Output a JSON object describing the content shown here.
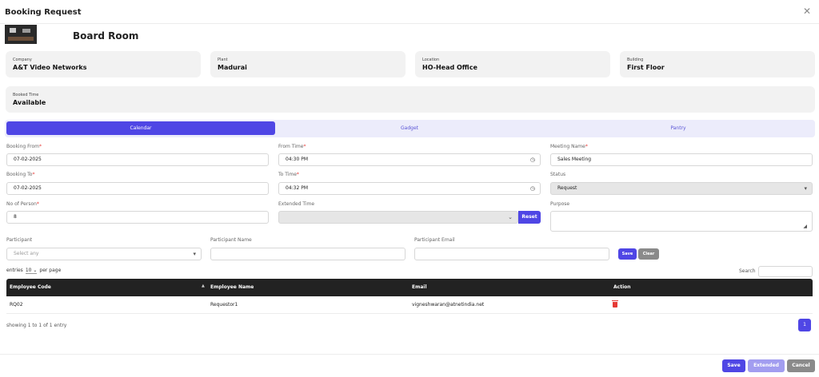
{
  "dialog": {
    "title": "Booking Request"
  },
  "room": {
    "name": "Board Room"
  },
  "info_cards": [
    {
      "label": "Company",
      "value": "A&T Video Networks"
    },
    {
      "label": "Plant",
      "value": "Madurai"
    },
    {
      "label": "Location",
      "value": "HO-Head Office"
    },
    {
      "label": "Building",
      "value": "First Floor"
    },
    {
      "label": "Booked Time",
      "value": "Available"
    }
  ],
  "tabs": [
    {
      "label": "Calendar",
      "active": true
    },
    {
      "label": "Gadget",
      "active": false
    },
    {
      "label": "Pantry",
      "active": false
    }
  ],
  "form": {
    "booking_from": {
      "label": "Booking From",
      "value": "07-02-2025"
    },
    "from_time": {
      "label": "From Time",
      "value": "04:30 PM"
    },
    "meeting_name": {
      "label": "Meeting Name",
      "value": "Sales Meeting"
    },
    "booking_to": {
      "label": "Booking To",
      "value": "07-02-2025"
    },
    "to_time": {
      "label": "To Time",
      "value": "04:32 PM"
    },
    "status": {
      "label": "Status",
      "value": "Request"
    },
    "no_of_person": {
      "label": "No of Person",
      "value": "8"
    },
    "extended_time": {
      "label": "Extended Time",
      "value": ""
    },
    "reset_label": "Reset",
    "purpose": {
      "label": "Purpose",
      "value": ""
    },
    "required_mark": "*"
  },
  "participant": {
    "select_label": "Participant",
    "select_placeholder": "Select any",
    "name_label": "Participant Name",
    "email_label": "Participant Email",
    "save_label": "Save",
    "clear_label": "Clear"
  },
  "table": {
    "entries_prefix": "entries",
    "entries_value": "10",
    "entries_suffix": "per page",
    "search_label": "Search",
    "headers": [
      "Employee Code",
      "Employee Name",
      "Email",
      "Action"
    ],
    "rows": [
      {
        "code": "RQ02",
        "name": "Requestor1",
        "email": "vigneshwaran@atnetindia.net"
      }
    ],
    "showing": "showing 1 to 1 of 1 entry",
    "page": "1"
  },
  "footer": {
    "save_label": "Save",
    "extended_label": "Extended",
    "cancel_label": "Cancel"
  },
  "icons": {
    "close": "✕",
    "clock": "◷",
    "caret_down": "▾",
    "chevron_down": "⌄",
    "sort": "▲",
    "resize": "◢"
  },
  "colors": {
    "primary": "#4f46e5",
    "primary_light": "#a29df0",
    "tab_bg": "#ececfb",
    "table_header": "#222222",
    "danger": "#e53935"
  }
}
